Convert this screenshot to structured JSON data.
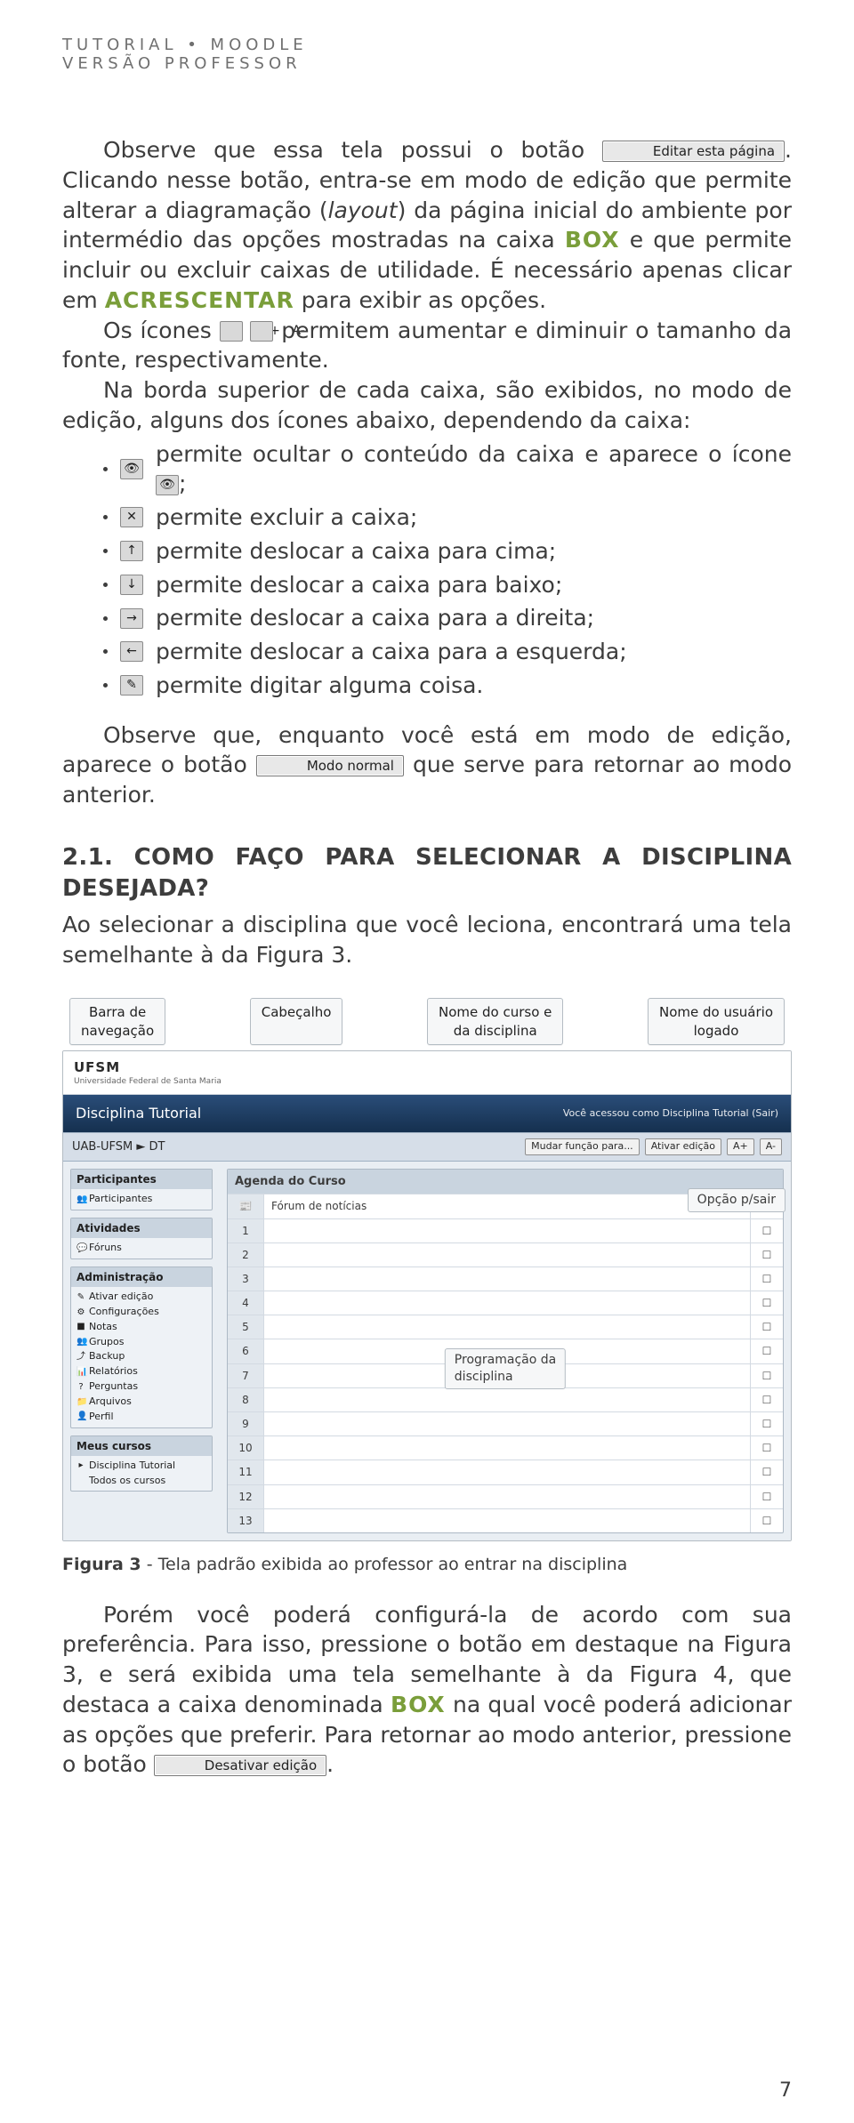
{
  "header": {
    "line1": "TUTORIAL • MOODLE",
    "line2": "VERSÃO PROFESSOR"
  },
  "p1_a": "Observe que essa tela possui o botão ",
  "btn_edit": "Editar esta página",
  "p1_b": ". Clicando nesse botão, entra-se em modo de edição que permite alterar a diagramação (",
  "p1_layout": "layout",
  "p1_c": ") da página inicial do ambiente por intermédio das opções mostradas na caixa ",
  "word_box": "BOX",
  "p1_d": " e que permite incluir ou excluir caixas de utilidade. É necessário apenas clicar em ",
  "word_acrescentar": "ACRESCENTAR",
  "p1_e": " para exibir as opções.",
  "p2_a": "Os ícones ",
  "ico_Aplus": "A+",
  "ico_Aminus": "A-",
  "p2_b": " permitem aumentar e diminuir o tamanho da fonte, respectivamente.",
  "p3": "Na borda superior de cada caixa, são exibidos, no modo de edição, alguns dos ícones abaixo, dependendo da caixa:",
  "bullets": [
    {
      "icon": "👁",
      "text_a": "permite ocultar o conteúdo da caixa e aparece o ícone ",
      "icon2": "👁",
      "text_b": ";"
    },
    {
      "icon": "✕",
      "text_a": "permite excluir a caixa;",
      "icon2": "",
      "text_b": ""
    },
    {
      "icon": "↑",
      "text_a": "permite deslocar a caixa para cima;",
      "icon2": "",
      "text_b": ""
    },
    {
      "icon": "↓",
      "text_a": "permite deslocar a caixa para baixo;",
      "icon2": "",
      "text_b": ""
    },
    {
      "icon": "→",
      "text_a": "permite deslocar a caixa para a direita;",
      "icon2": "",
      "text_b": ""
    },
    {
      "icon": "←",
      "text_a": "permite deslocar a caixa para a esquerda;",
      "icon2": "",
      "text_b": ""
    },
    {
      "icon": "✎",
      "text_a": "permite digitar alguma coisa.",
      "icon2": "",
      "text_b": ""
    }
  ],
  "p4_a": "Observe que, enquanto você está em modo de edição, aparece o botão ",
  "btn_normal": "Modo normal",
  "p4_b": " que serve para retornar ao modo anterior.",
  "sec_title": "2.1. COMO FAÇO PARA SELECIONAR A DISCIPLINA DESEJADA?",
  "sec_intro": "Ao selecionar a disciplina que você leciona, encontrará uma tela semelhante à da Figura 3.",
  "fig": {
    "callouts_top": {
      "nav": "Barra de\nnavegação",
      "cab": "Cabeçalho",
      "curso": "Nome do curso e\nda disciplina",
      "user": "Nome do usuário\nlogado"
    },
    "callout_right": "Opção p/sair",
    "callout_mid": "Programação da\ndisciplina",
    "logo": "UFSM",
    "logo_sub": "Universidade Federal de Santa Maria",
    "title": "Disciplina Tutorial",
    "breadcrumb": "UAB-UFSM ► DT",
    "login_text": "Você acessou como Disciplina Tutorial (Sair)",
    "role_lbl": "Mudar função para...",
    "btn_ativar": "Ativar edição",
    "aplus": "A+",
    "aminus": "A-",
    "side": {
      "participantes_hdr": "Participantes",
      "participantes_item": "Participantes",
      "atividades_hdr": "Atividades",
      "atividades_item": "Fóruns",
      "admin_hdr": "Administração",
      "admin_items": [
        "Ativar edição",
        "Configurações",
        "Notas",
        "Grupos",
        "Backup",
        "Relatórios",
        "Perguntas",
        "Arquivos",
        "Perfil"
      ],
      "cursos_hdr": "Meus cursos",
      "cursos_items": [
        "Disciplina Tutorial",
        "Todos os cursos"
      ]
    },
    "agenda_hdr": "Agenda do Curso",
    "forum_row": "Fórum de notícias",
    "rows": [
      "1",
      "2",
      "3",
      "4",
      "5",
      "6",
      "7",
      "8",
      "9",
      "10",
      "11",
      "12",
      "13"
    ]
  },
  "fig_caption_b": "Figura 3",
  "fig_caption_t": " - Tela padrão exibida ao professor ao entrar na disciplina",
  "p5_a": "Porém você poderá configurá-la de acordo com sua preferência. Para isso, pressione o botão  em destaque na Figura 3, e será exibida uma tela semelhante à da Figura 4, que destaca a caixa denominada ",
  "p5_b": " na qual você poderá adicionar as opções que preferir. Para retornar ao modo anterior, pressione o botão ",
  "btn_desativar": "Desativar edição",
  "p5_c": ".",
  "page_num": "7"
}
